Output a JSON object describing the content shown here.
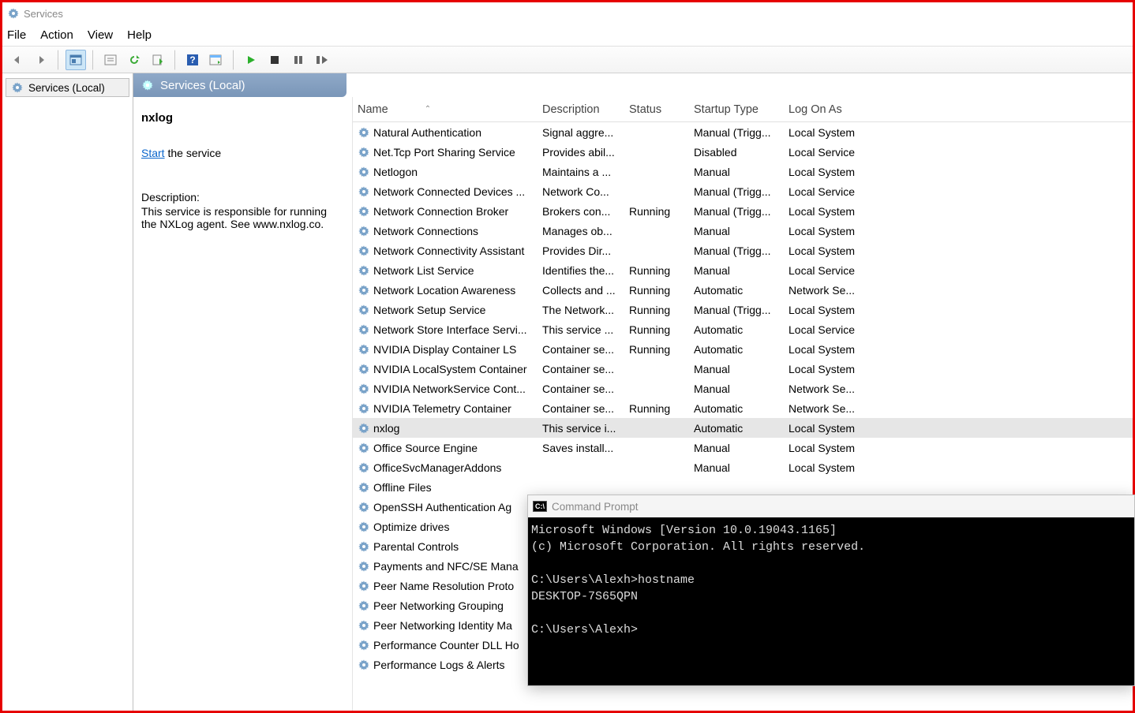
{
  "window": {
    "title": "Services"
  },
  "menu": {
    "file": "File",
    "action": "Action",
    "view": "View",
    "help": "Help"
  },
  "tree": {
    "root": "Services (Local)"
  },
  "header": {
    "title": "Services (Local)"
  },
  "selected": {
    "name": "nxlog",
    "start_link": "Start",
    "start_suffix": " the service",
    "desc_label": "Description:",
    "desc_body": "This service is responsible for running the NXLog agent. See www.nxlog.co."
  },
  "columns": {
    "name": "Name",
    "desc": "Description",
    "status": "Status",
    "startup": "Startup Type",
    "logon": "Log On As"
  },
  "rows": [
    {
      "name": "Natural Authentication",
      "desc": "Signal aggre...",
      "status": "",
      "startup": "Manual (Trigg...",
      "logon": "Local System"
    },
    {
      "name": "Net.Tcp Port Sharing Service",
      "desc": "Provides abil...",
      "status": "",
      "startup": "Disabled",
      "logon": "Local Service"
    },
    {
      "name": "Netlogon",
      "desc": "Maintains a ...",
      "status": "",
      "startup": "Manual",
      "logon": "Local System"
    },
    {
      "name": "Network Connected Devices ...",
      "desc": "Network Co...",
      "status": "",
      "startup": "Manual (Trigg...",
      "logon": "Local Service"
    },
    {
      "name": "Network Connection Broker",
      "desc": "Brokers con...",
      "status": "Running",
      "startup": "Manual (Trigg...",
      "logon": "Local System"
    },
    {
      "name": "Network Connections",
      "desc": "Manages ob...",
      "status": "",
      "startup": "Manual",
      "logon": "Local System"
    },
    {
      "name": "Network Connectivity Assistant",
      "desc": "Provides Dir...",
      "status": "",
      "startup": "Manual (Trigg...",
      "logon": "Local System"
    },
    {
      "name": "Network List Service",
      "desc": "Identifies the...",
      "status": "Running",
      "startup": "Manual",
      "logon": "Local Service"
    },
    {
      "name": "Network Location Awareness",
      "desc": "Collects and ...",
      "status": "Running",
      "startup": "Automatic",
      "logon": "Network Se..."
    },
    {
      "name": "Network Setup Service",
      "desc": "The Network...",
      "status": "Running",
      "startup": "Manual (Trigg...",
      "logon": "Local System"
    },
    {
      "name": "Network Store Interface Servi...",
      "desc": "This service ...",
      "status": "Running",
      "startup": "Automatic",
      "logon": "Local Service"
    },
    {
      "name": "NVIDIA Display Container LS",
      "desc": "Container se...",
      "status": "Running",
      "startup": "Automatic",
      "logon": "Local System"
    },
    {
      "name": "NVIDIA LocalSystem Container",
      "desc": "Container se...",
      "status": "",
      "startup": "Manual",
      "logon": "Local System"
    },
    {
      "name": "NVIDIA NetworkService Cont...",
      "desc": "Container se...",
      "status": "",
      "startup": "Manual",
      "logon": "Network Se..."
    },
    {
      "name": "NVIDIA Telemetry Container",
      "desc": "Container se...",
      "status": "Running",
      "startup": "Automatic",
      "logon": "Network Se..."
    },
    {
      "name": "nxlog",
      "desc": "This service i...",
      "status": "",
      "startup": "Automatic",
      "logon": "Local System",
      "selected": true
    },
    {
      "name": "Office  Source Engine",
      "desc": "Saves install...",
      "status": "",
      "startup": "Manual",
      "logon": "Local System"
    },
    {
      "name": "OfficeSvcManagerAddons",
      "desc": "",
      "status": "",
      "startup": "Manual",
      "logon": "Local System"
    },
    {
      "name": "Offline Files",
      "desc": "",
      "status": "",
      "startup": "",
      "logon": ""
    },
    {
      "name": "OpenSSH Authentication Ag",
      "desc": "",
      "status": "",
      "startup": "",
      "logon": ""
    },
    {
      "name": "Optimize drives",
      "desc": "",
      "status": "",
      "startup": "",
      "logon": ""
    },
    {
      "name": "Parental Controls",
      "desc": "",
      "status": "",
      "startup": "",
      "logon": ""
    },
    {
      "name": "Payments and NFC/SE Mana",
      "desc": "",
      "status": "",
      "startup": "",
      "logon": ""
    },
    {
      "name": "Peer Name Resolution Proto",
      "desc": "",
      "status": "",
      "startup": "",
      "logon": ""
    },
    {
      "name": "Peer Networking Grouping",
      "desc": "",
      "status": "",
      "startup": "",
      "logon": ""
    },
    {
      "name": "Peer Networking Identity Ma",
      "desc": "",
      "status": "",
      "startup": "",
      "logon": ""
    },
    {
      "name": "Performance Counter DLL Ho",
      "desc": "",
      "status": "",
      "startup": "",
      "logon": ""
    },
    {
      "name": "Performance Logs & Alerts",
      "desc": "",
      "status": "",
      "startup": "",
      "logon": ""
    }
  ],
  "cmd": {
    "title": "Command Prompt",
    "line1": "Microsoft Windows [Version 10.0.19043.1165]",
    "line2": "(c) Microsoft Corporation. All rights reserved.",
    "line3": "C:\\Users\\Alexh>hostname",
    "line4": "DESKTOP-7S65QPN",
    "line5": "C:\\Users\\Alexh>"
  }
}
